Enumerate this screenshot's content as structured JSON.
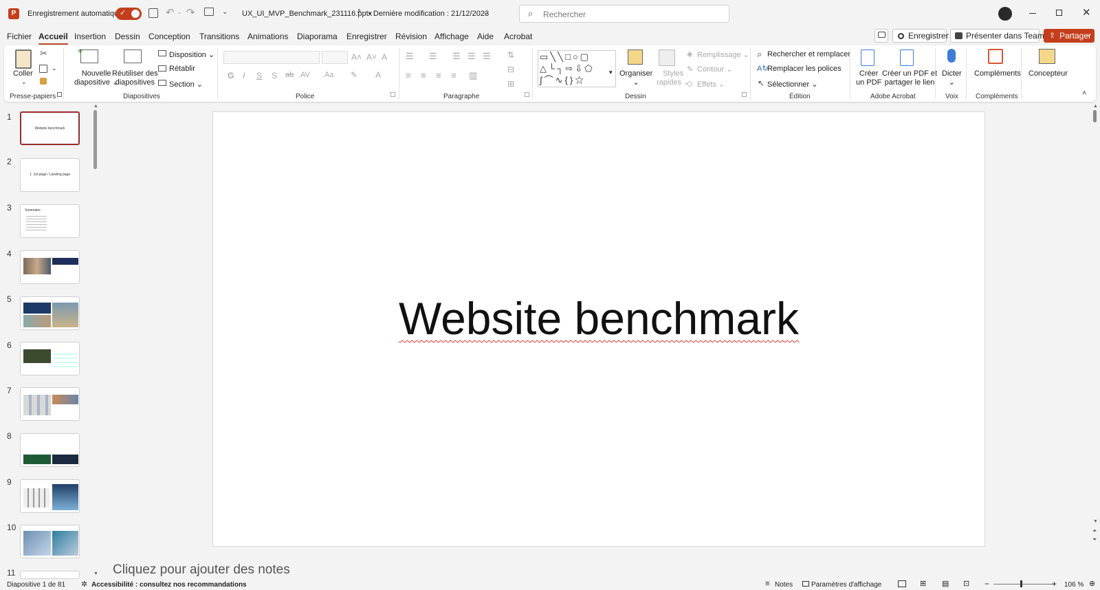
{
  "titlebar": {
    "autosave_label": "Enregistrement automatique",
    "filename": "UX_UI_MVP_Benchmark_231116.pptx",
    "last_modified": "• Dernière modification : 21/12/2023",
    "search_placeholder": "Rechercher"
  },
  "menu": {
    "tabs": [
      "Fichier",
      "Accueil",
      "Insertion",
      "Dessin",
      "Conception",
      "Transitions",
      "Animations",
      "Diaporama",
      "Enregistrer",
      "Révision",
      "Affichage",
      "Aide",
      "Acrobat"
    ],
    "active": "Accueil",
    "record_button": "Enregistrer",
    "teams_button": "Présenter dans Teams",
    "share_button": "Partager"
  },
  "ribbon": {
    "clipboard": {
      "paste": "Coller",
      "group": "Presse-papiers"
    },
    "slides": {
      "new_slide_1": "Nouvelle",
      "new_slide_2": "diapositive",
      "reuse_1": "Réutiliser des",
      "reuse_2": "diapositives",
      "layout": "Disposition",
      "reset": "Rétablir",
      "section": "Section",
      "group": "Diapositives"
    },
    "font": {
      "group": "Police"
    },
    "paragraph": {
      "group": "Paragraphe"
    },
    "drawing": {
      "arrange": "Organiser",
      "quick_styles_1": "Styles",
      "quick_styles_2": "rapides",
      "fill": "Remplissage",
      "outline": "Contour",
      "effects": "Effets",
      "group": "Dessin"
    },
    "editing": {
      "find_replace": "Rechercher et remplacer",
      "replace_fonts": "Remplacer les polices",
      "select": "Sélectionner",
      "group": "Édition"
    },
    "acrobat": {
      "create_pdf_1": "Créer",
      "create_pdf_2": "un PDF",
      "share_pdf_1": "Créer un PDF et",
      "share_pdf_2": "partager le lien",
      "group": "Adobe Acrobat"
    },
    "voice": {
      "dictate": "Dicter",
      "group": "Voix"
    },
    "addins": {
      "addins": "Compléments",
      "group": "Compléments"
    },
    "designer": {
      "designer": "Concepteur"
    }
  },
  "thumbnails": [
    {
      "num": "1",
      "text": "Website benchmark"
    },
    {
      "num": "2",
      "text": "1. 1st page / Landing page"
    },
    {
      "num": "3",
      "text": "Sommaire"
    },
    {
      "num": "4",
      "text": ""
    },
    {
      "num": "5",
      "text": ""
    },
    {
      "num": "6",
      "text": ""
    },
    {
      "num": "7",
      "text": ""
    },
    {
      "num": "8",
      "text": ""
    },
    {
      "num": "9",
      "text": ""
    },
    {
      "num": "10",
      "text": ""
    },
    {
      "num": "11",
      "text": ""
    }
  ],
  "slide": {
    "title": "Website benchmark"
  },
  "notes_placeholder": "Cliquez pour ajouter des notes",
  "status": {
    "slide_counter": "Diapositive 1 de 81",
    "accessibility": "Accessibilité : consultez nos recommandations",
    "notes": "Notes",
    "display_settings": "Paramètres d'affichage",
    "zoom": "106 %"
  },
  "colors": {
    "accent": "#b7472a",
    "share_bg": "#c43e1c"
  }
}
